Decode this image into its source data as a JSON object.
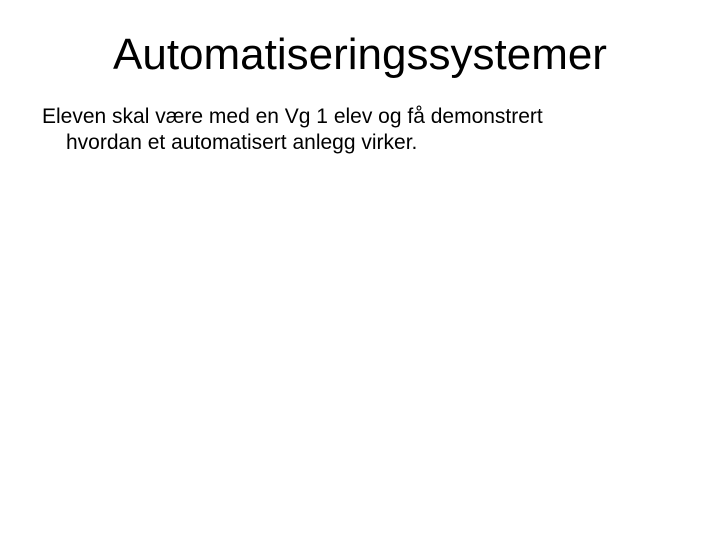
{
  "slide": {
    "title": "Automatiseringssystemer",
    "body_line1": "Eleven skal være med en Vg 1 elev og få demonstrert",
    "body_line2": "hvordan et automatisert anlegg virker."
  }
}
